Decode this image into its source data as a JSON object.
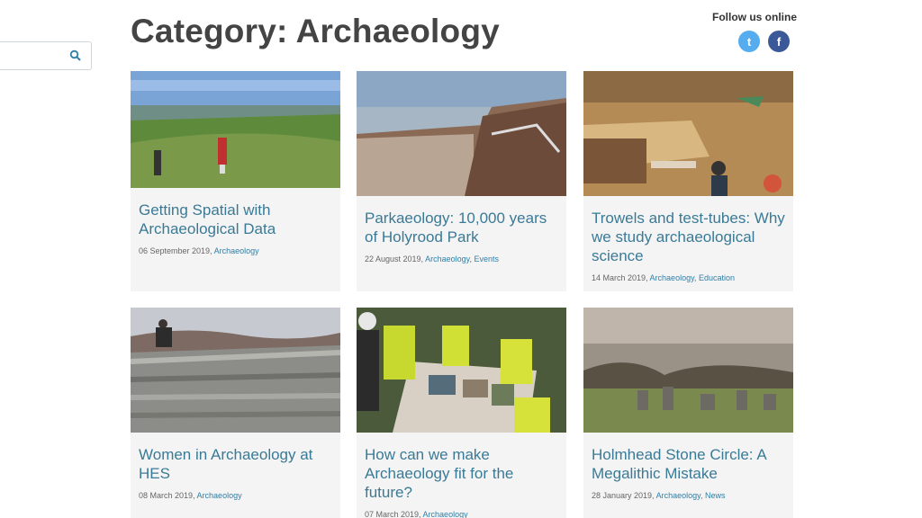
{
  "search": {
    "placeholder": ""
  },
  "page": {
    "title": "Category: Archaeology"
  },
  "social": {
    "label": "Follow us online",
    "twitter_icon": "twitter-icon",
    "facebook_icon": "facebook-icon",
    "twitter_glyph": "t",
    "facebook_glyph": "f",
    "colors": {
      "twitter": "#55acee",
      "facebook": "#3b5998"
    }
  },
  "posts": [
    {
      "title": "Getting Spatial with Archaeological Data",
      "date": "06 September 2019, ",
      "categories": [
        "Archaeology"
      ]
    },
    {
      "title": "Parkaeology: 10,000 years of Holyrood Park",
      "date": "22 August 2019, ",
      "categories": [
        "Archaeology",
        "Events"
      ]
    },
    {
      "title": "Trowels and test-tubes: Why we study archaeological science",
      "date": "14 March 2019, ",
      "categories": [
        "Archaeology",
        "Education"
      ]
    },
    {
      "title": "Women in Archaeology at HES",
      "date": "08 March 2019, ",
      "categories": [
        "Archaeology"
      ]
    },
    {
      "title": "How can we make Archaeology fit for the future?",
      "date": "07 March 2019, ",
      "categories": [
        "Archaeology"
      ]
    },
    {
      "title": "Holmhead Stone Circle: A Megalithic Mistake",
      "date": "28 January 2019, ",
      "categories": [
        "Archaeology",
        "News"
      ]
    }
  ],
  "separator": ", ",
  "theme": {
    "link": "#2f7fa8",
    "title": "#3a7a96",
    "card_bg": "#f4f4f4"
  }
}
